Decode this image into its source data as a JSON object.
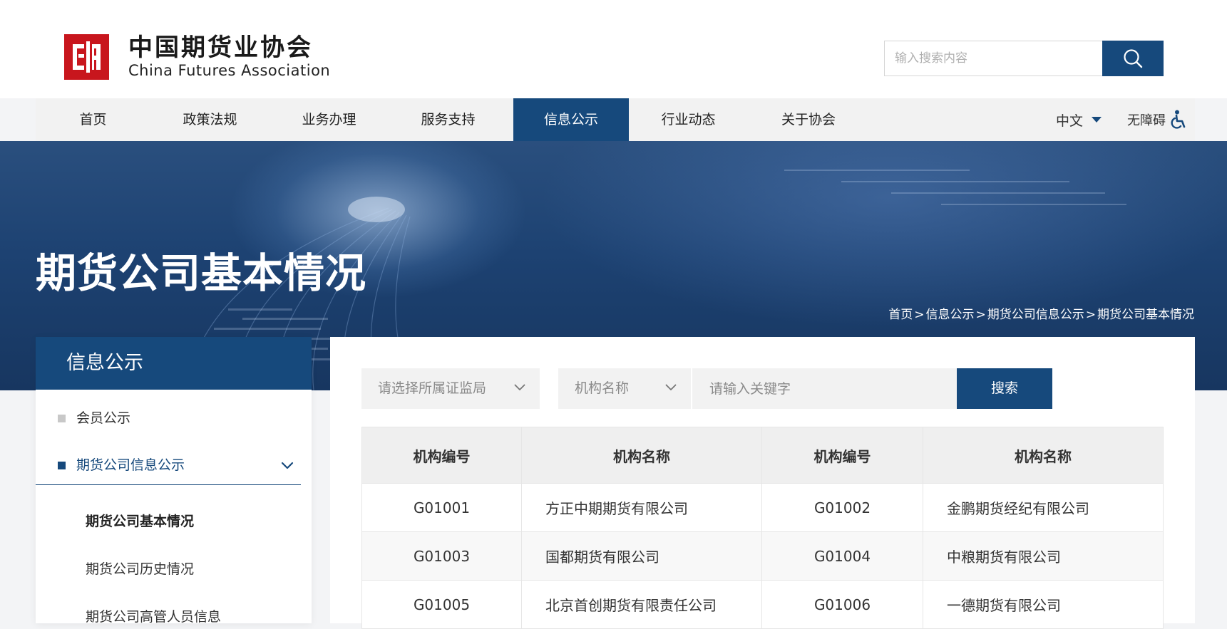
{
  "header": {
    "logo_cn": "中国期货业协会",
    "logo_en": "China Futures Association",
    "search_placeholder": "输入搜索内容"
  },
  "nav": {
    "items": [
      {
        "label": "首页",
        "active": false
      },
      {
        "label": "政策法规",
        "active": false
      },
      {
        "label": "业务办理",
        "active": false
      },
      {
        "label": "服务支持",
        "active": false
      },
      {
        "label": "信息公示",
        "active": true
      },
      {
        "label": "行业动态",
        "active": false
      },
      {
        "label": "关于协会",
        "active": false
      }
    ],
    "language": "中文",
    "accessibility": "无障碍"
  },
  "banner": {
    "title": "期货公司基本情况",
    "breadcrumb": [
      "首页",
      "信息公示",
      "期货公司信息公示",
      "期货公司基本情况"
    ]
  },
  "sidebar": {
    "title": "信息公示",
    "items": [
      {
        "label": "会员公示",
        "active": false
      },
      {
        "label": "期货公司信息公示",
        "active": true,
        "expanded": true
      }
    ],
    "subitems": [
      {
        "label": "期货公司基本情况",
        "active": true
      },
      {
        "label": "期货公司历史情况",
        "active": false
      },
      {
        "label": "期货公司高管人员信息",
        "active": false
      }
    ]
  },
  "filters": {
    "region_placeholder": "请选择所属证监局",
    "field_selected": "机构名称",
    "keyword_placeholder": "请输入关键字",
    "search_label": "搜索"
  },
  "table": {
    "headers": [
      "机构编号",
      "机构名称",
      "机构编号",
      "机构名称"
    ],
    "rows": [
      [
        "G01001",
        "方正中期期货有限公司",
        "G01002",
        "金鹏期货经纪有限公司"
      ],
      [
        "G01003",
        "国都期货有限公司",
        "G01004",
        "中粮期货有限公司"
      ],
      [
        "G01005",
        "北京首创期货有限责任公司",
        "G01006",
        "一德期货有限公司"
      ]
    ]
  },
  "colors": {
    "primary": "#16497c",
    "logo_red": "#c8161d",
    "nav_bg": "#f2f2f2",
    "page_bg": "#f3f4f6"
  }
}
